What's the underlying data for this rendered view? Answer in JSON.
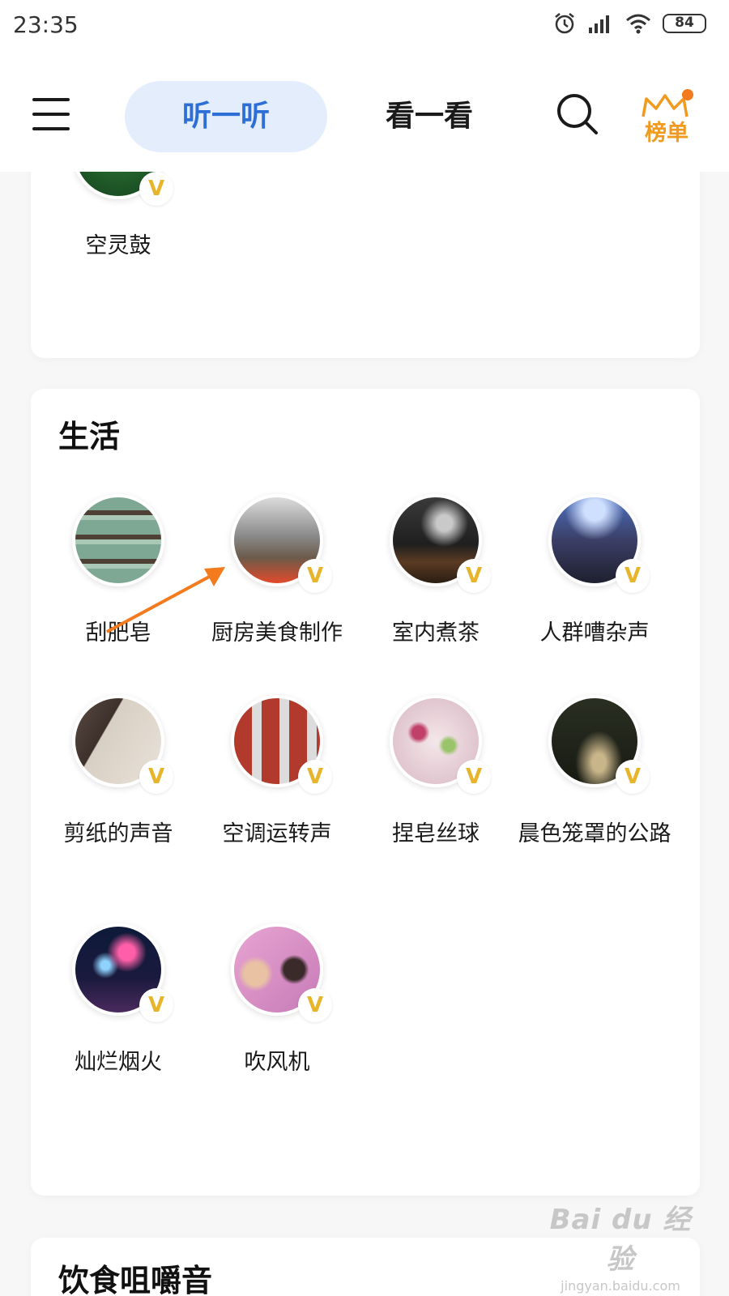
{
  "status_bar": {
    "time": "23:35",
    "battery": "84"
  },
  "header": {
    "tabs": [
      {
        "label": "听一听",
        "active": true
      },
      {
        "label": "看一看",
        "active": false
      }
    ],
    "ranking_label": "榜单",
    "accent_color": "#2d6fd6",
    "ranking_color": "#f09a20"
  },
  "previous_section": {
    "items": [
      {
        "label": "空灵鼓",
        "vip": true,
        "icon": "ethereal-drum-thumbnail"
      }
    ]
  },
  "life_section": {
    "title": "生活",
    "items": [
      {
        "label": "刮肥皂",
        "vip": false,
        "icon": "soap-thumbnail"
      },
      {
        "label": "厨房美食制作",
        "vip": true,
        "icon": "kitchen-cooking-thumbnail"
      },
      {
        "label": "室内煮茶",
        "vip": true,
        "icon": "tea-brewing-thumbnail"
      },
      {
        "label": "人群嘈杂声",
        "vip": true,
        "icon": "crowd-thumbnail"
      },
      {
        "label": "剪纸的声音",
        "vip": true,
        "icon": "paper-cutting-thumbnail"
      },
      {
        "label": "空调运转声",
        "vip": true,
        "icon": "air-conditioner-thumbnail"
      },
      {
        "label": "捏皂丝球",
        "vip": true,
        "icon": "soap-ball-thumbnail"
      },
      {
        "label": "晨色笼罩的公路",
        "vip": true,
        "icon": "morning-road-thumbnail"
      },
      {
        "label": "灿烂烟火",
        "vip": true,
        "icon": "fireworks-thumbnail"
      },
      {
        "label": "吹风机",
        "vip": true,
        "icon": "hair-dryer-thumbnail"
      }
    ]
  },
  "next_section": {
    "title": "饮食咀嚼音"
  },
  "vip_badge": "V",
  "watermark": {
    "logo": "Bai du 经验",
    "url": "jingyan.baidu.com"
  }
}
